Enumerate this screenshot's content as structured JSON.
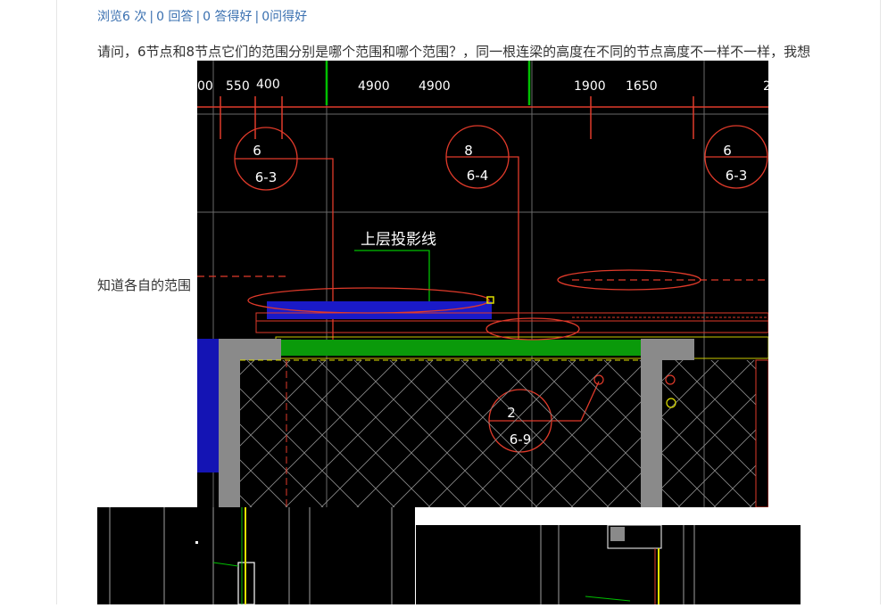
{
  "stats": {
    "views": "浏览6 次",
    "answers": "0 回答",
    "good_answers": "0 答得好",
    "good_questions": "0问得好",
    "separator": "|"
  },
  "question": {
    "line1": "请问，6节点和8节点它们的范围分别是哪个范围和哪个范围？，同一根连梁的高度在不同的节点高度不一样不一样，我想",
    "line2": "知道各自的范围"
  },
  "drawing": {
    "dims": [
      "00",
      "550",
      "400",
      "4900",
      "4900",
      "1900",
      "1650",
      "2"
    ],
    "callouts": [
      {
        "top": "6",
        "bottom": "6-3"
      },
      {
        "top": "8",
        "bottom": "6-4"
      },
      {
        "top": "6",
        "bottom": "6-3"
      },
      {
        "top": "2",
        "bottom": "6-9"
      }
    ],
    "projection_label": "上层投影线"
  },
  "colors": {
    "link": "#3a70b0",
    "text": "#333333",
    "cad_bg": "#000000",
    "cad_red": "#e03a2a",
    "cad_green": "#00a000",
    "cad_blue": "#1010c0",
    "cad_gray": "#8a8a8a"
  }
}
